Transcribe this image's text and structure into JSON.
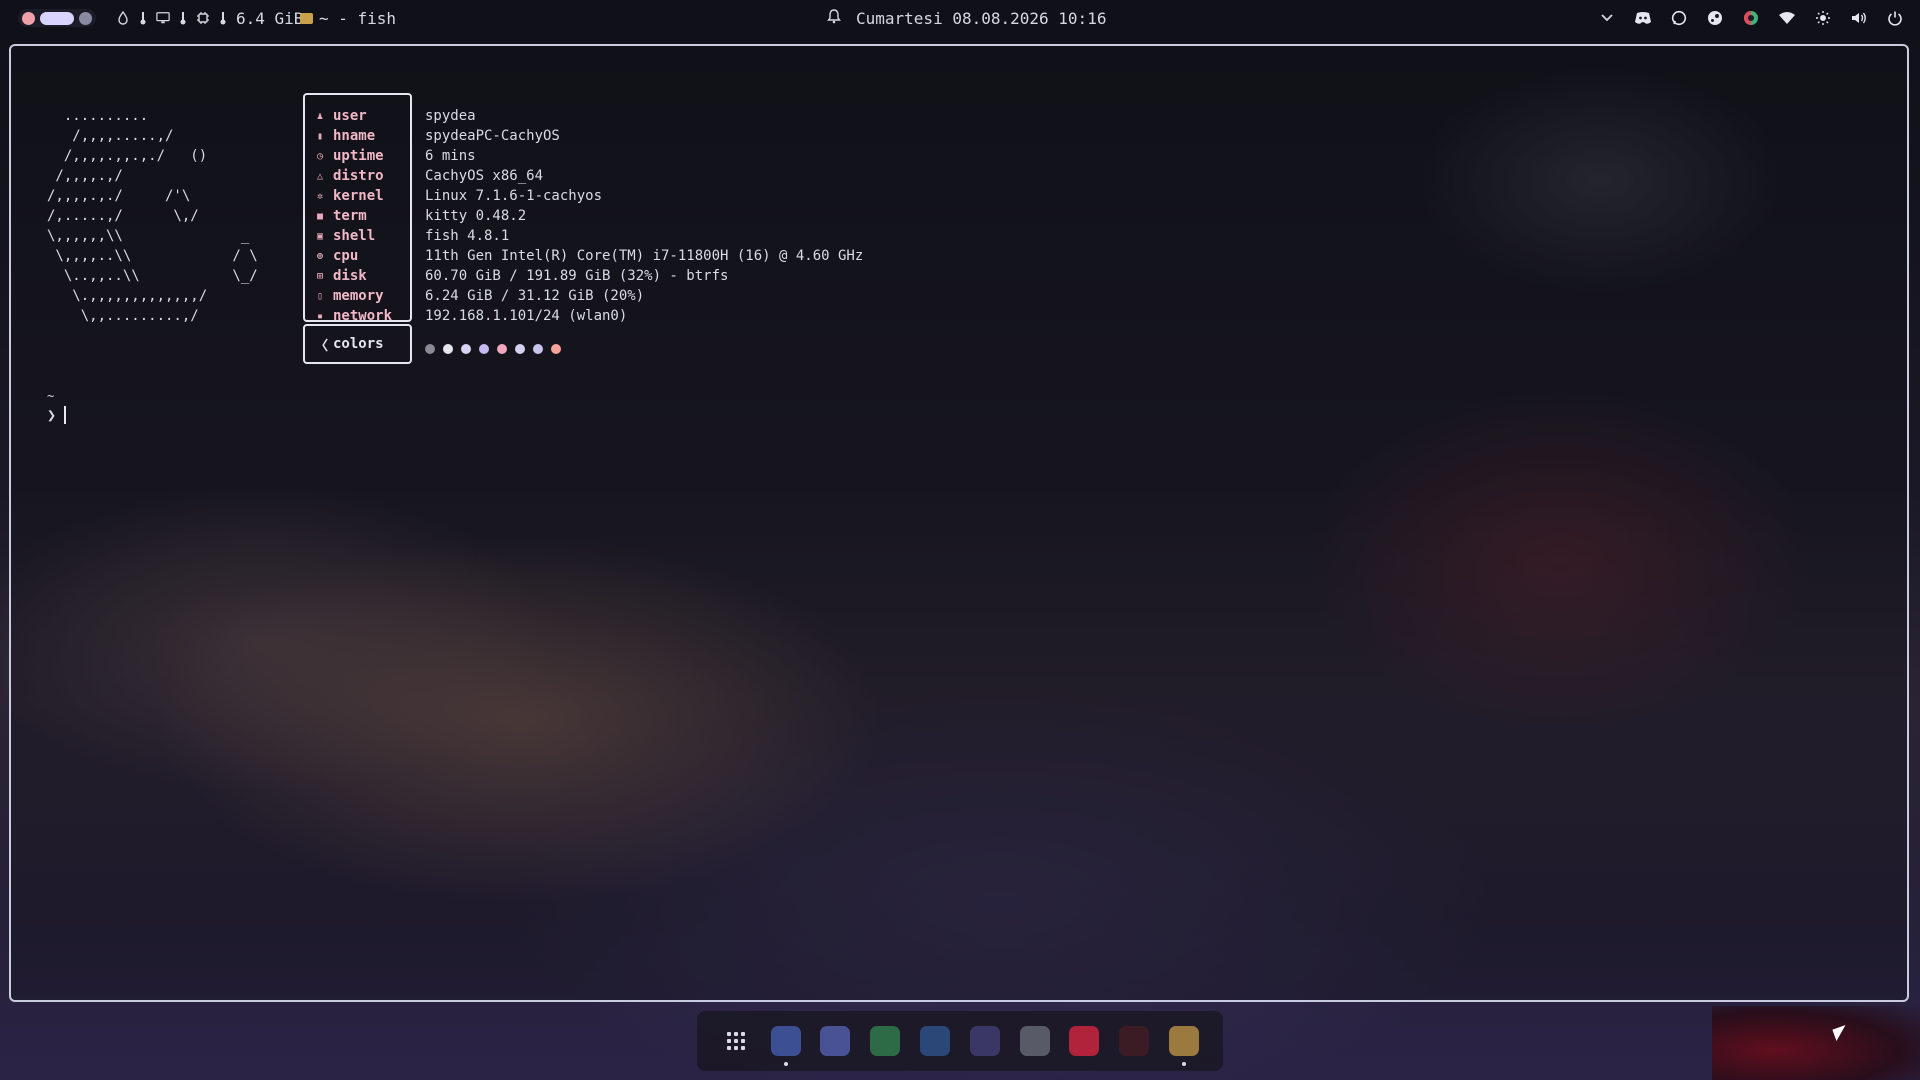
{
  "topbar": {
    "memory": "6.4 GiB",
    "window_title": "~ - fish",
    "datetime": "Cumartesi 08.08.2026 10:16",
    "tray_icons": [
      "chevron-down-icon",
      "discord-icon",
      "whatsapp-icon",
      "steam-icon",
      "app-icon",
      "wifi-icon",
      "brightness-icon",
      "volume-icon",
      "power-icon"
    ]
  },
  "terminal": {
    "ascii_art": "  ..........\n   /,,,,.....,/\n  /,,,,.,,.,./   ()\n /,,,,.,/\n/,,,,.,./     /'\\\n/,.....,/      \\,/\n\\,,,,,,\\\\              _\n \\,,,,..\\\\            / \\\n  \\..,,..\\\\           \\_/\n   \\.,,,,,,,,,,,,,/\n    \\,,.........,/",
    "info": [
      {
        "key": "user",
        "icon": "user-icon",
        "value": "spydea"
      },
      {
        "key": "hname",
        "icon": "host-icon",
        "value": "spydeaPC-CachyOS"
      },
      {
        "key": "uptime",
        "icon": "clock-icon",
        "value": "6 mins"
      },
      {
        "key": "distro",
        "icon": "distro-icon",
        "value": "CachyOS x86_64"
      },
      {
        "key": "kernel",
        "icon": "gear-icon",
        "value": "Linux 7.1.6-1-cachyos"
      },
      {
        "key": "term",
        "icon": "terminal-icon",
        "value": "kitty 0.48.2"
      },
      {
        "key": "shell",
        "icon": "shell-icon",
        "value": "fish 4.8.1"
      },
      {
        "key": "cpu",
        "icon": "cpu-icon",
        "value": "11th Gen Intel(R) Core(TM) i7-11800H (16) @ 4.60 GHz"
      },
      {
        "key": "disk",
        "icon": "disk-icon",
        "value": "60.70 GiB / 191.89 GiB (32%) - btrfs"
      },
      {
        "key": "memory",
        "icon": "memory-icon",
        "value": "6.24 GiB / 31.12 GiB (20%)"
      },
      {
        "key": "network",
        "icon": "network-icon",
        "value": "192.168.1.101/24 (wlan0)"
      }
    ],
    "colors_label": "colors",
    "color_swatches": [
      "#8a8a96",
      "#e6e6ee",
      "#d7d3f6",
      "#c6b9f2",
      "#f2a7bf",
      "#d6d0f0",
      "#c7c5ee",
      "#f7a39a"
    ],
    "prompt_dir": "~",
    "prompt_symbol": "❯"
  },
  "dock": {
    "apps": [
      {
        "name": "app-launcher",
        "color": "transparent",
        "running": false
      },
      {
        "name": "snowflake-app",
        "color": "#3d4f93",
        "running": true
      },
      {
        "name": "discord",
        "color": "#4a5296",
        "running": false
      },
      {
        "name": "whatsapp",
        "color": "#2d6b47",
        "running": false
      },
      {
        "name": "steam",
        "color": "#2a4778",
        "running": false
      },
      {
        "name": "cachyos",
        "color": "#3a3766",
        "running": false
      },
      {
        "name": "obs",
        "color": "#595a68",
        "running": false
      },
      {
        "name": "media-player",
        "color": "#b0233a",
        "running": false
      },
      {
        "name": "hidden-app",
        "color": "#3b1c24",
        "running": false
      },
      {
        "name": "kitty-terminal",
        "color": "#9a7a3e",
        "running": true
      }
    ]
  }
}
